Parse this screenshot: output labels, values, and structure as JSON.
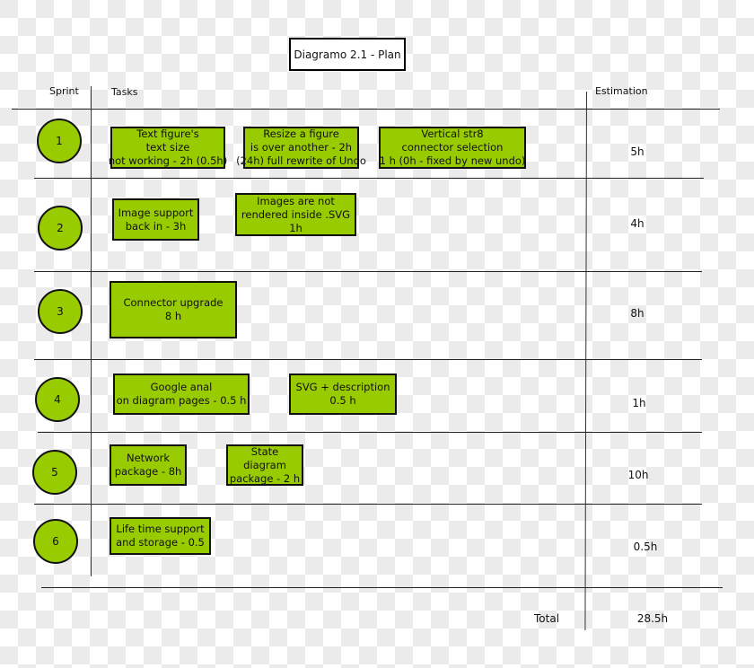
{
  "title": "Diagramo 2.1 - Plan",
  "headers": {
    "sprint": "Sprint",
    "tasks": "Tasks",
    "estimation": "Estimation"
  },
  "colors": {
    "task_fill": "#99cc00",
    "border": "#111111",
    "checker_light": "#ffffff",
    "checker_dark": "#ebebeb"
  },
  "sprints": [
    {
      "number": "1",
      "estimation": "5h",
      "tasks": [
        "Text figure's\ntext size\nnot working - 2h (0.5h)",
        "Resize a figure\nis over another - 2h\n(24h) full rewrite of Undo",
        "Vertical str8\nconnector selection\n1 h (0h - fixed by new undo)"
      ]
    },
    {
      "number": "2",
      "estimation": "4h",
      "tasks": [
        "Image support\nback in - 3h",
        "Images are not\nrendered inside .SVG\n1h"
      ]
    },
    {
      "number": "3",
      "estimation": "8h",
      "tasks": [
        "Connector upgrade\n8 h"
      ]
    },
    {
      "number": "4",
      "estimation": "1h",
      "tasks": [
        "Google anal\non diagram pages - 0.5 h",
        "SVG + description\n0.5 h"
      ]
    },
    {
      "number": "5",
      "estimation": "10h",
      "tasks": [
        "Network\npackage - 8h",
        "State\ndiagram\npackage - 2 h"
      ]
    },
    {
      "number": "6",
      "estimation": "0.5h",
      "tasks": [
        "Life time support\nand storage - 0.5"
      ]
    }
  ],
  "total": {
    "label": "Total",
    "value": "28.5h"
  }
}
